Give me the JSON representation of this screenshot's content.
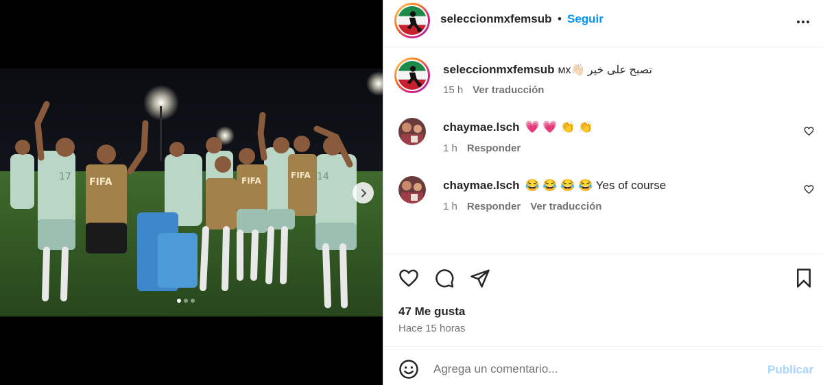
{
  "post": {
    "username": "seleccionmxfemsub",
    "follow_label": "Seguir",
    "bullet": "•",
    "caption_text": "ᴍx👋🏻 تصبح على خير",
    "caption_time": "15 h",
    "caption_translate": "Ver traducción"
  },
  "comments": [
    {
      "username": "chaymae.lsch",
      "text": "💗 💗 👏 👏",
      "time": "1 h",
      "reply": "Responder"
    },
    {
      "username": "chaymae.lsch",
      "text": "😂 😂 😂 😂 Yes of course",
      "time": "1 h",
      "reply": "Responder",
      "translate": "Ver traducción"
    }
  ],
  "actions": {
    "likes": "47 Me gusta",
    "time_ago": "Hace 15 horas"
  },
  "composer": {
    "placeholder": "Agrega un comentario...",
    "publish_label": "Publicar"
  },
  "carousel": {
    "slides": 3,
    "active_index": 0
  },
  "icons": {
    "more": "more-options-icon",
    "heart": "heart-icon",
    "comment": "comment-icon",
    "share": "share-icon",
    "save": "bookmark-icon",
    "emoji": "emoji-icon",
    "next": "chevron-right-icon"
  },
  "colors": {
    "accent": "#0095f6",
    "publish_disabled": "#a9d4fb",
    "text": "#262626",
    "muted": "#737373"
  }
}
